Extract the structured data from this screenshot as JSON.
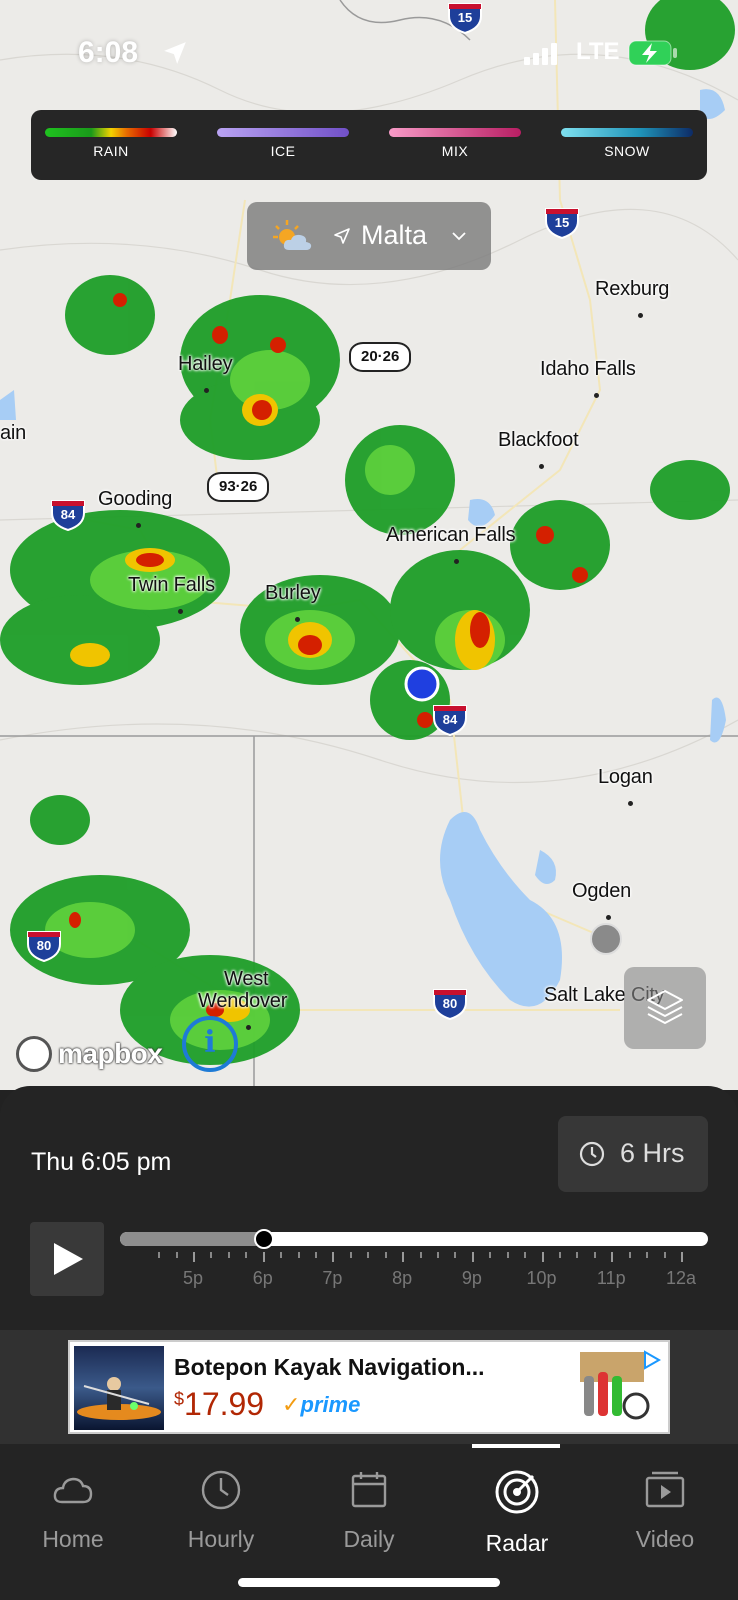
{
  "status_bar": {
    "time": "6:08",
    "network": "LTE"
  },
  "legend": [
    {
      "label": "RAIN",
      "gradient": "linear-gradient(90deg,#1fc21f,#1a9a1a 35%,#f2d200 50%,#e86b00 62%,#c80000 80%,#ffffff)"
    },
    {
      "label": "ICE",
      "gradient": "linear-gradient(90deg,#b9a3f2,#7150c8)"
    },
    {
      "label": "MIX",
      "gradient": "linear-gradient(90deg,#f79bc7,#b81e63)"
    },
    {
      "label": "SNOW",
      "gradient": "linear-gradient(90deg,#7fe0ef,#1f93b8 60%,#0d2b66)"
    }
  ],
  "location": {
    "name": "Malta"
  },
  "map": {
    "cities": [
      "Rexburg",
      "Idaho Falls",
      "Hailey",
      "Blackfoot",
      "Gooding",
      "American Falls",
      "Twin Falls",
      "Burley",
      "Logan",
      "Ogden",
      "West",
      "Wendover",
      "Salt Lake City",
      "ain"
    ],
    "shields": {
      "i15_top": "15",
      "i15": "15",
      "us20": "20·26",
      "us93": "93·26",
      "i84_w": "84",
      "i84_e": "84",
      "i80_w": "80",
      "i80_e": "80",
      "us93_top": "93"
    },
    "attribution": "mapbox"
  },
  "timeline": {
    "label": "Thu 6:05 pm",
    "range_button": "6 Hrs",
    "progress": 0.245,
    "hours": [
      "5p",
      "6p",
      "7p",
      "8p",
      "9p",
      "10p",
      "11p",
      "12a"
    ]
  },
  "ad": {
    "title": "Botepon Kayak Navigation...",
    "price_symbol": "$",
    "price": "17.99",
    "prime": "prime"
  },
  "tabs": [
    {
      "label": "Home",
      "icon": "cloud-icon"
    },
    {
      "label": "Hourly",
      "icon": "clock-icon"
    },
    {
      "label": "Daily",
      "icon": "calendar-icon"
    },
    {
      "label": "Radar",
      "icon": "radar-icon",
      "active": true
    },
    {
      "label": "Video",
      "icon": "video-icon"
    }
  ]
}
